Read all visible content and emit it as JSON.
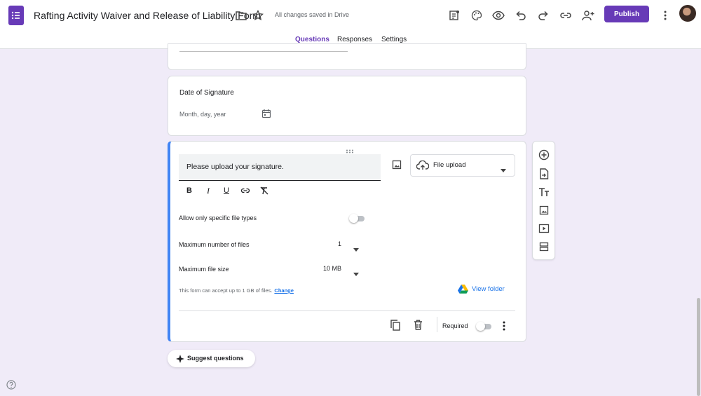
{
  "app": {
    "doc_title": "Rafting Activity Waiver and Release of Liability Form",
    "save_status": "All changes saved in Drive",
    "publish_label": "Publish",
    "accent_color": "#673ab7",
    "header_icons": [
      "folder-icon",
      "star-icon",
      "customize-icon",
      "palette-icon",
      "preview-icon",
      "undo-icon",
      "redo-icon",
      "link-icon",
      "add-collaborator-icon",
      "more-vert-icon"
    ]
  },
  "tabs": [
    {
      "label": "Questions",
      "active": true
    },
    {
      "label": "Responses",
      "active": false
    },
    {
      "label": "Settings",
      "active": false
    }
  ],
  "date_question": {
    "title": "Date of Signature",
    "placeholder": "Month, day, year"
  },
  "upload_question": {
    "question_text": "Please upload your signature.",
    "type_label": "File upload",
    "options": {
      "specific_types_label": "Allow only specific file types",
      "specific_types_enabled": false,
      "max_files_label": "Maximum number of files",
      "max_files_value": "1",
      "max_size_label": "Maximum file size",
      "max_size_value": "10 MB"
    },
    "note_text": "This form can accept up to 1 GB of files.",
    "note_link": "Change",
    "view_folder_label": "View folder",
    "required_label": "Required",
    "required_enabled": false
  },
  "side_toolbar": [
    "add-question-icon",
    "import-questions-icon",
    "add-title-icon",
    "add-image-icon",
    "add-video-icon",
    "add-section-icon"
  ],
  "suggest_label": "Suggest questions"
}
